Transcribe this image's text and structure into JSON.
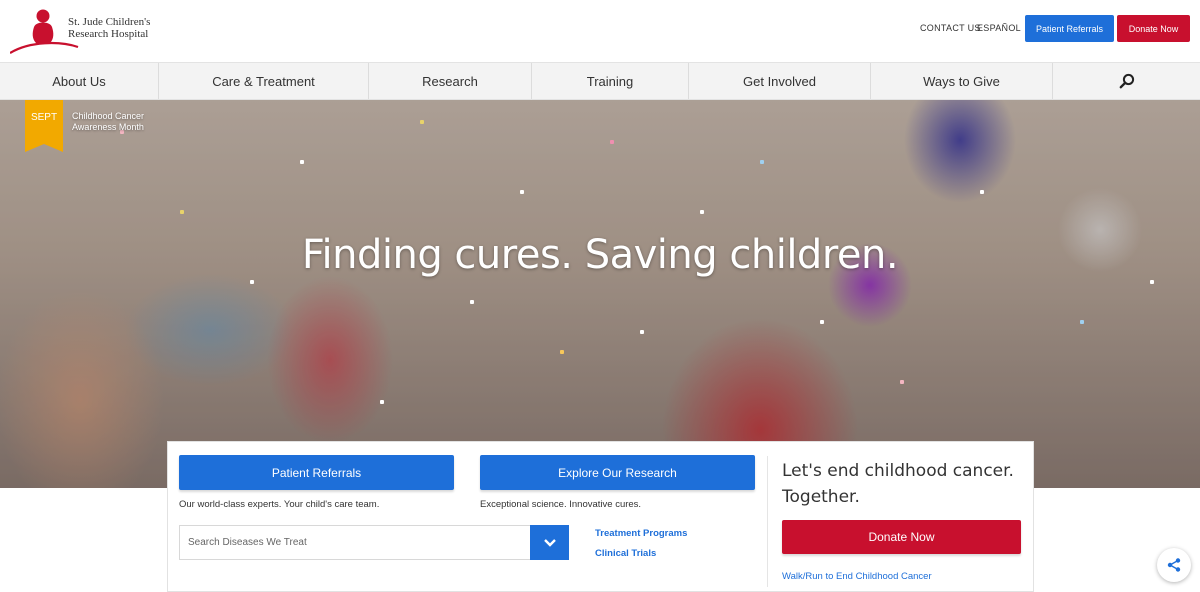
{
  "brand": {
    "name_line1": "St. Jude Children's",
    "name_line2": "Research Hospital",
    "color_red": "#c8102e",
    "color_blue": "#1e6fd9"
  },
  "utility": {
    "contact": "CONTACT US",
    "espanol": "ESPAÑOL",
    "patient_referrals": "Patient Referrals",
    "donate_now": "Donate Now"
  },
  "nav": {
    "items": [
      {
        "label": "About Us"
      },
      {
        "label": "Care & Treatment"
      },
      {
        "label": "Research"
      },
      {
        "label": "Training"
      },
      {
        "label": "Get Involved"
      },
      {
        "label": "Ways to Give"
      }
    ],
    "search_icon": "search-icon"
  },
  "hero": {
    "badge": "SEPT",
    "caption_line1": "Childhood Cancer",
    "caption_line2": "Awareness Month",
    "title": "Finding cures. Saving children."
  },
  "actions": {
    "patient_referrals": "Patient Referrals",
    "patient_referrals_desc": "Our world-class experts. Your child's care team.",
    "explore_research": "Explore Our Research",
    "explore_research_desc": "Exceptional science. Innovative cures.",
    "search_placeholder": "Search Diseases We Treat",
    "treatment_programs": "Treatment Programs",
    "clinical_trials": "Clinical Trials",
    "tagline_line1": "Let's end childhood cancer.",
    "tagline_line2": "Together.",
    "donate_now": "Donate Now",
    "walk_run": "Walk/Run to End Childhood Cancer"
  },
  "share_icon": "share-icon"
}
